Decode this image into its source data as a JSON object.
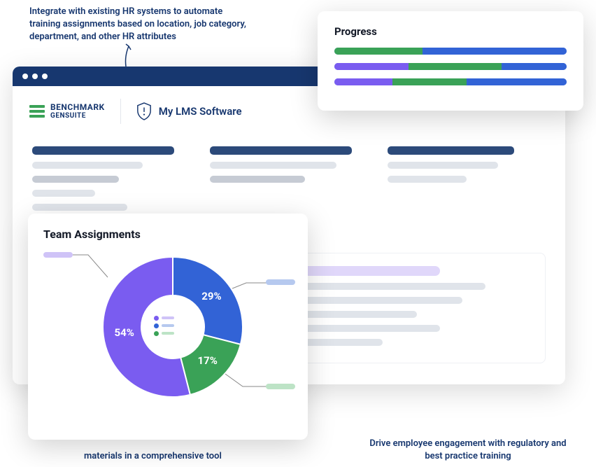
{
  "annotations": {
    "top": "Integrate with existing HR systems to automate training assignments based on location, job category, department, and other HR attributes",
    "bottom_left": "materials in a comprehensive tool",
    "bottom_right": "Drive employee engagement with regulatory and best practice training"
  },
  "logo": {
    "line1": "BENCHMARK",
    "line2": "GENSUITE"
  },
  "app_title": "My LMS Software",
  "progress": {
    "title": "Progress",
    "bars": [
      {
        "segments": [
          {
            "color": "green",
            "pct": 38
          },
          {
            "color": "blue",
            "pct": 62
          }
        ]
      },
      {
        "segments": [
          {
            "color": "purple",
            "pct": 32
          },
          {
            "color": "green",
            "pct": 40
          },
          {
            "color": "blue",
            "pct": 28
          }
        ]
      },
      {
        "segments": [
          {
            "color": "purple",
            "pct": 25
          },
          {
            "color": "green",
            "pct": 32
          },
          {
            "color": "blue",
            "pct": 43
          }
        ]
      }
    ]
  },
  "team": {
    "title": "Team Assignments"
  },
  "chart_data": {
    "type": "pie",
    "title": "Team Assignments",
    "series": [
      {
        "name": "purple",
        "color": "#7a5cf0",
        "value": 54
      },
      {
        "name": "blue",
        "color": "#3263d6",
        "value": 29
      },
      {
        "name": "green",
        "color": "#3aa257",
        "value": 17
      }
    ]
  }
}
